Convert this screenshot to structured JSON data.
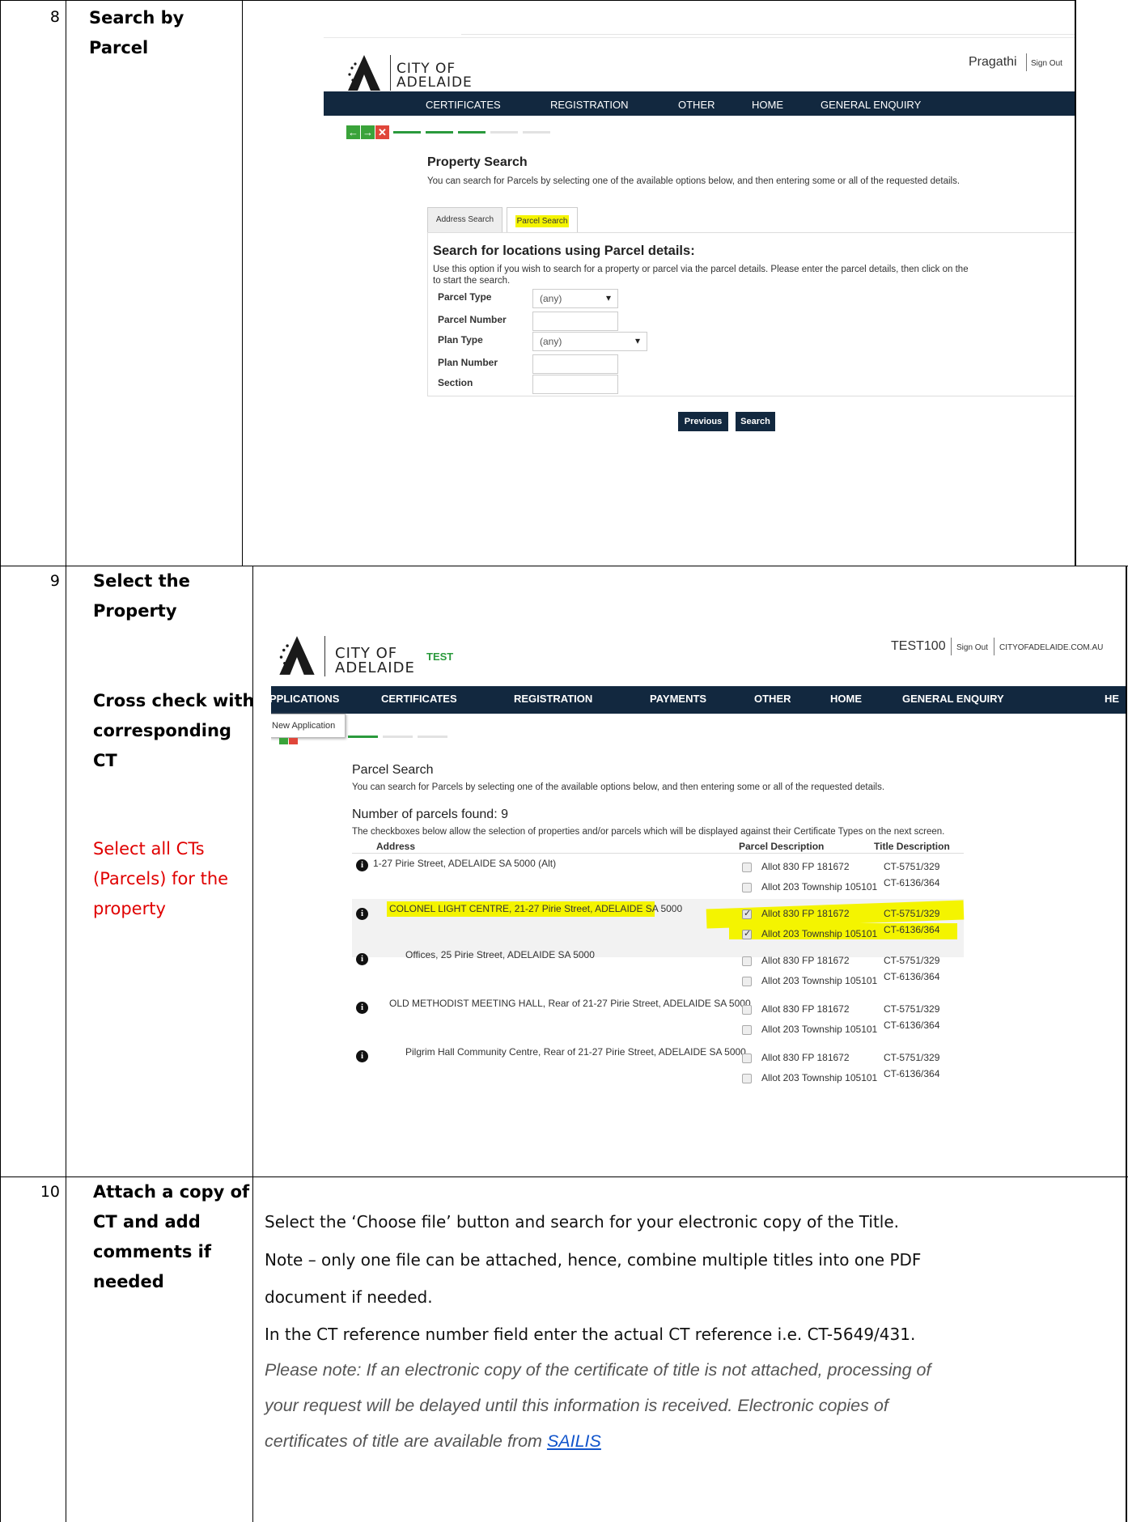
{
  "rows": [
    {
      "num": "8",
      "step": [
        "Search by",
        "Parcel"
      ]
    },
    {
      "num": "9",
      "step": [
        "Select the",
        "Property"
      ],
      "note": [
        "Cross check with",
        "corresponding",
        "CT"
      ],
      "red": [
        "Select all CTs",
        "(Parcels) for the",
        "property"
      ]
    },
    {
      "num": "10",
      "step": [
        "Attach a copy of",
        "CT and add",
        "comments if",
        "needed"
      ]
    }
  ],
  "shot8": {
    "logo_line1": "CITY OF",
    "logo_line2": "ADELAIDE",
    "user": "Pragathi",
    "signout": "Sign Out",
    "nav": [
      "CERTIFICATES",
      "REGISTRATION",
      "OTHER",
      "HOME",
      "GENERAL ENQUIRY"
    ],
    "title": "Property Search",
    "intro": "You can search for Parcels by selecting one of the available options below, and then entering some or all of the requested details.",
    "tabs": [
      "Address Search",
      "Parcel Search"
    ],
    "heading": "Search for locations using Parcel details:",
    "desc1": "Use this option if you wish to search for a property or parcel via the parcel details. Please enter the parcel details, then click on the",
    "desc2": "to start the search.",
    "fields": {
      "parcel_type": "Parcel Type",
      "parcel_number": "Parcel Number",
      "plan_type": "Plan Type",
      "plan_number": "Plan Number",
      "section": "Section"
    },
    "any": "(any)",
    "btn_prev": "Previous",
    "btn_search": "Search"
  },
  "shot9": {
    "logo_line1": "CITY OF",
    "logo_line2": "ADELAIDE",
    "test": "TEST",
    "user": "TEST100",
    "signout": "Sign Out",
    "site": "CITYOFADELAIDE.COM.AU",
    "nav": [
      "PPLICATIONS",
      "CERTIFICATES",
      "REGISTRATION",
      "PAYMENTS",
      "OTHER",
      "HOME",
      "GENERAL ENQUIRY",
      "HE"
    ],
    "dropdown": "New Application",
    "title": "Parcel Search",
    "intro": "You can search for Parcels by selecting one of the available options below, and then entering some or all of the requested details.",
    "count": "Number of parcels found: 9",
    "checktext": "The checkboxes below allow the selection of properties and/or parcels which will be displayed against their Certificate Types on the next screen.",
    "col_address": "Address",
    "col_parcel": "Parcel Description",
    "col_title": "Title Description",
    "items": [
      {
        "address": "1-27 Pirie Street, ADELAIDE SA 5000 (Alt)",
        "p1": "Allot 830 FP 181672",
        "t1": "CT-5751/329",
        "p2": "Allot 203 Township 105101",
        "t2": "CT-6136/364"
      },
      {
        "address": "COLONEL LIGHT CENTRE, 21-27 Pirie Street, ADELAIDE SA 5000",
        "p1": "Allot 830 FP 181672",
        "t1": "CT-5751/329",
        "p2": "Allot 203 Township 105101",
        "t2": "CT-6136/364"
      },
      {
        "address": "Offices, 25 Pirie Street, ADELAIDE SA 5000",
        "p1": "Allot 830 FP 181672",
        "t1": "CT-5751/329",
        "p2": "Allot 203 Township 105101",
        "t2": "CT-6136/364"
      },
      {
        "address": "OLD METHODIST MEETING HALL, Rear of 21-27 Pirie Street, ADELAIDE SA 5000",
        "p1": "Allot 830 FP 181672",
        "t1": "CT-5751/329",
        "p2": "Allot 203 Township 105101",
        "t2": "CT-6136/364"
      },
      {
        "address": "Pilgrim Hall Community Centre, Rear of 21-27 Pirie Street, ADELAIDE SA 5000",
        "p1": "Allot 830 FP 181672",
        "t1": "CT-5751/329",
        "p2": "Allot 203 Township 105101",
        "t2": "CT-6136/364"
      }
    ]
  },
  "row10": {
    "l1": "Select the ‘Choose file’ button and search for your electronic copy of the Title.",
    "l2": "Note – only one file can be attached, hence, combine multiple titles into one PDF",
    "l3": "document if needed.",
    "l4": "In the CT reference number field enter the actual CT reference i.e. CT-5649/431.",
    "i1": "Please note: If an electronic copy of the certificate of title is not attached, processing of",
    "i2": "your request will be delayed until this information is received. Electronic copies of",
    "i3": "certificates of title are available from",
    "link": "SAILIS"
  }
}
